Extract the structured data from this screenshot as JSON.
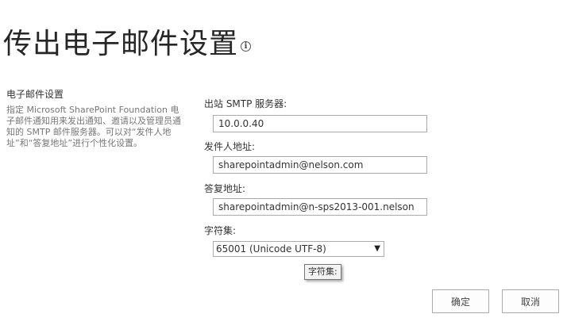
{
  "page": {
    "title": "传出电子邮件设置",
    "info_icon": "info-icon"
  },
  "section": {
    "heading": "电子邮件设置",
    "description": "指定 Microsoft SharePoint Foundation 电子邮件通知用来发出通知、邀请以及管理员通知的 SMTP 邮件服务器。可以对“发件人地址”和“答复地址”进行个性化设置。"
  },
  "form": {
    "smtp_label": "出站 SMTP 服务器:",
    "smtp_value": "10.0.0.40",
    "from_label": "发件人地址:",
    "from_value": "sharepointadmin@nelson.com",
    "reply_label": "答复地址:",
    "reply_value": "sharepointadmin@n-sps2013-001.nelson",
    "charset_label": "字符集:",
    "charset_value": "65001 (Unicode UTF-8)",
    "charset_tooltip": "字符集:"
  },
  "actions": {
    "ok_label": "确定",
    "cancel_label": "取消"
  }
}
